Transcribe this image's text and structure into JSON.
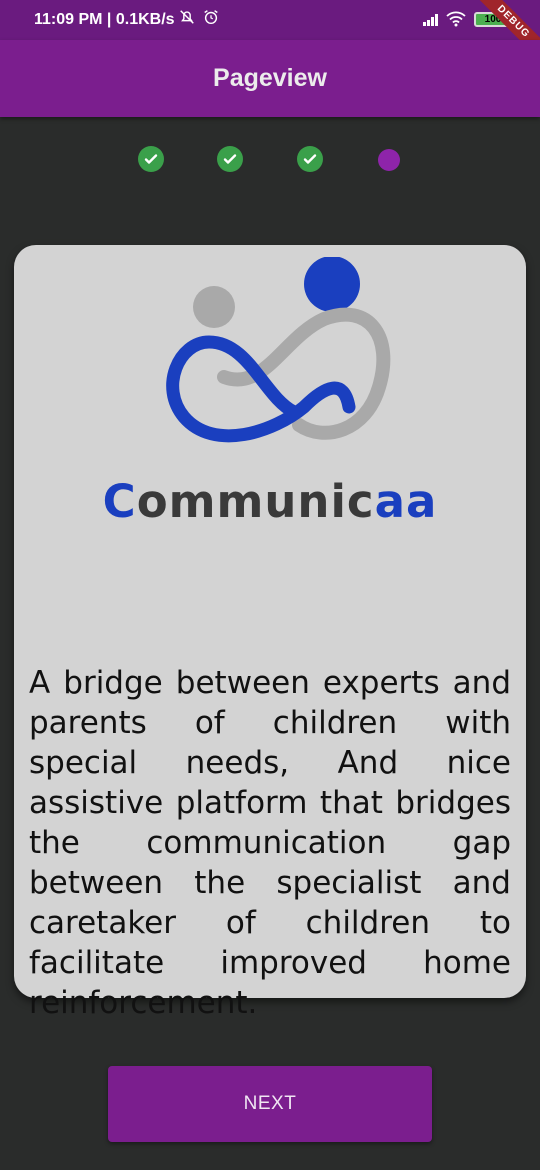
{
  "status_bar": {
    "time_speed": "11:09 PM | 0.1KB/s",
    "battery": "100",
    "debug_label": "DEBUG"
  },
  "app_bar": {
    "title": "Pageview"
  },
  "stepper": {
    "steps": [
      {
        "state": "done"
      },
      {
        "state": "done"
      },
      {
        "state": "done"
      },
      {
        "state": "current"
      }
    ],
    "done_color": "#3aa04a",
    "current_color": "#8e24aa"
  },
  "card": {
    "brand_first": "C",
    "brand_middle": "ommunic",
    "brand_last": "aa",
    "description": "A bridge between experts and parents of children with special needs, And nice assistive platform that bridges the communication gap between the specialist and caretaker of children to facilitate improved home reinforcement."
  },
  "colors": {
    "brand_blue": "#1a3fbf",
    "brand_gray": "#a9a9a9",
    "primary": "#7b1e8e"
  },
  "next_button": {
    "label": "NEXT"
  }
}
